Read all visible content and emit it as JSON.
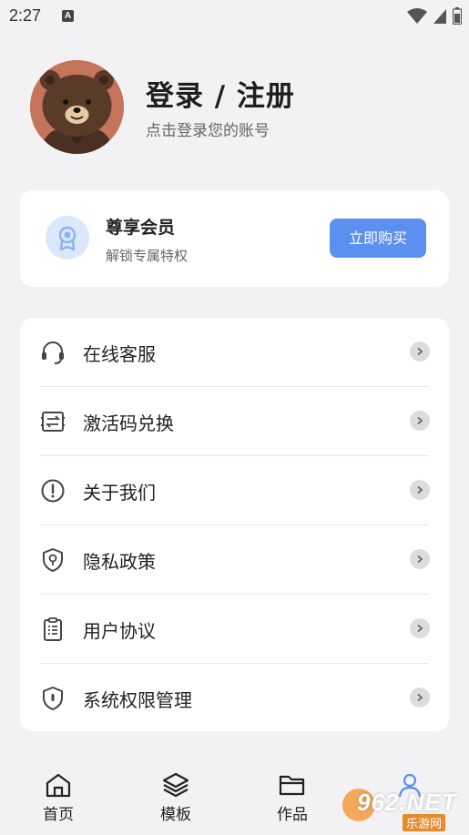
{
  "status_bar": {
    "time": "2:27",
    "notification_glyph": "A"
  },
  "profile": {
    "title": "登录 / 注册",
    "subtitle": "点击登录您的账号"
  },
  "vip": {
    "title": "尊享会员",
    "subtitle": "解锁专属特权",
    "button": "立即购买"
  },
  "menu": {
    "items": [
      {
        "label": "在线客服",
        "icon": "headset-icon"
      },
      {
        "label": "激活码兑换",
        "icon": "exchange-ticket-icon"
      },
      {
        "label": "关于我们",
        "icon": "info-circle-icon"
      },
      {
        "label": "隐私政策",
        "icon": "privacy-shield-icon"
      },
      {
        "label": "用户协议",
        "icon": "clipboard-icon"
      },
      {
        "label": "系统权限管理",
        "icon": "shield-lock-icon"
      }
    ]
  },
  "tabs": [
    {
      "label": "首页",
      "icon": "home-icon"
    },
    {
      "label": "模板",
      "icon": "layers-icon"
    },
    {
      "label": "作品",
      "icon": "folder-icon"
    },
    {
      "label": "",
      "icon": "user-icon"
    }
  ],
  "watermark": {
    "text": "962.NET",
    "sub": "乐游网"
  },
  "colors": {
    "accent": "#5b8ff0",
    "background": "#f2f2f4",
    "card": "#ffffff",
    "avatar_bg": "#c4745a"
  }
}
